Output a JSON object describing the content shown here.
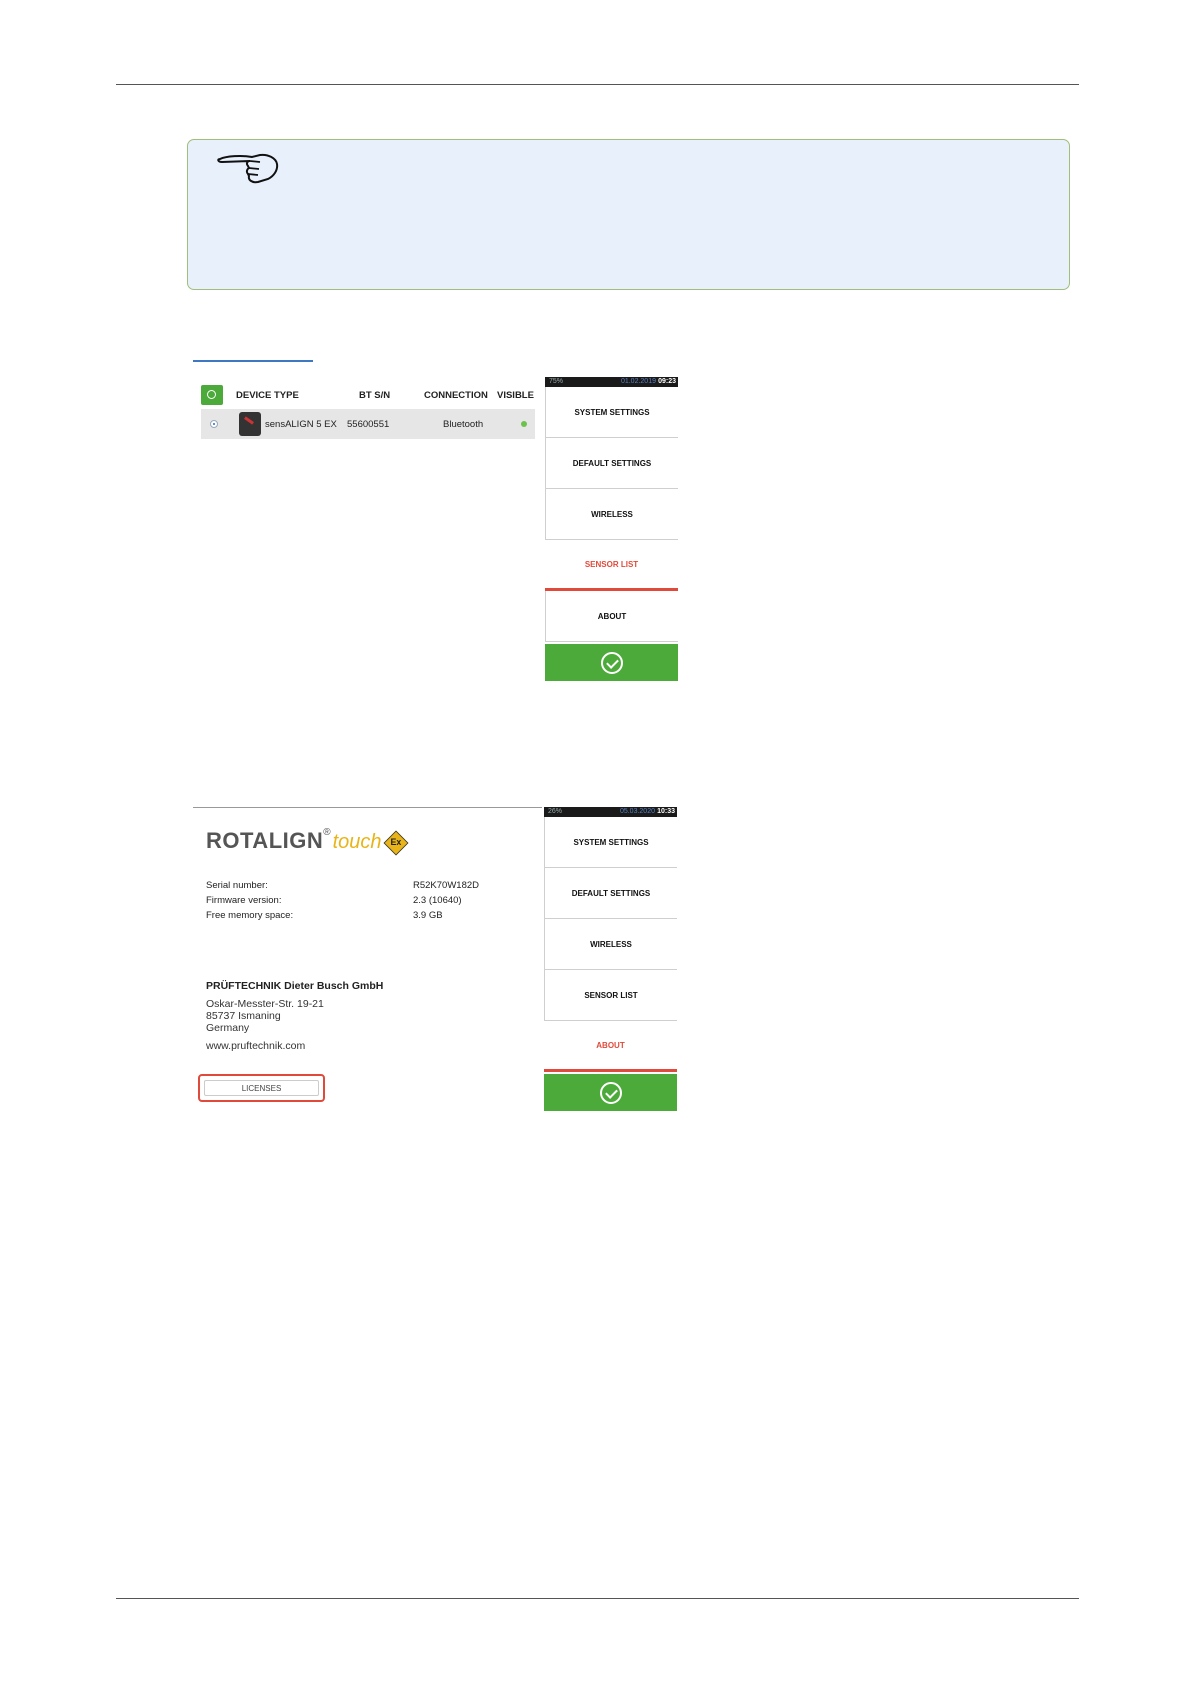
{
  "sensor_table": {
    "headers": {
      "device_type": "DEVICE TYPE",
      "bt_sn": "BT S/N",
      "connection": "CONNECTION",
      "visible": "VISIBLE"
    },
    "rows": [
      {
        "device": "sensALIGN 5 EX",
        "serial": "55600551",
        "connection": "Bluetooth",
        "visible_color": "#6cc24a"
      }
    ]
  },
  "menu_sensor_list": {
    "status": {
      "battery": "75%",
      "date": "01.02.2019",
      "time": "09:23"
    },
    "items": [
      "SYSTEM SETTINGS",
      "DEFAULT SETTINGS",
      "WIRELESS",
      "SENSOR LIST",
      "ABOUT"
    ],
    "active": "SENSOR LIST"
  },
  "menu_about": {
    "status": {
      "battery": "26%",
      "date": "05.03.2020",
      "time": "10:33"
    },
    "items": [
      "SYSTEM SETTINGS",
      "DEFAULT SETTINGS",
      "WIRELESS",
      "SENSOR LIST",
      "ABOUT"
    ],
    "active": "ABOUT"
  },
  "about": {
    "logo": {
      "brand": "ROTALIGN",
      "reg": "®",
      "suffix": "touch",
      "ex": "Ex"
    },
    "serial_label": "Serial number:",
    "serial_value": "R52K70W182D",
    "firmware_label": "Firmware version:",
    "firmware_value": "2.3 (10640)",
    "memory_label": "Free memory space:",
    "memory_value": "3.9 GB",
    "company": "PRÜFTECHNIK Dieter Busch GmbH",
    "street": "Oskar-Messter-Str. 19-21",
    "city": "85737 Ismaning",
    "country": "Germany",
    "website": "www.pruftechnik.com",
    "licenses_button": "LICENSES"
  },
  "colors": {
    "accent_green": "#4caa3a",
    "active_red": "#e04a3a",
    "note_bg": "#e8f0fb",
    "note_border": "#9fbf7a"
  }
}
